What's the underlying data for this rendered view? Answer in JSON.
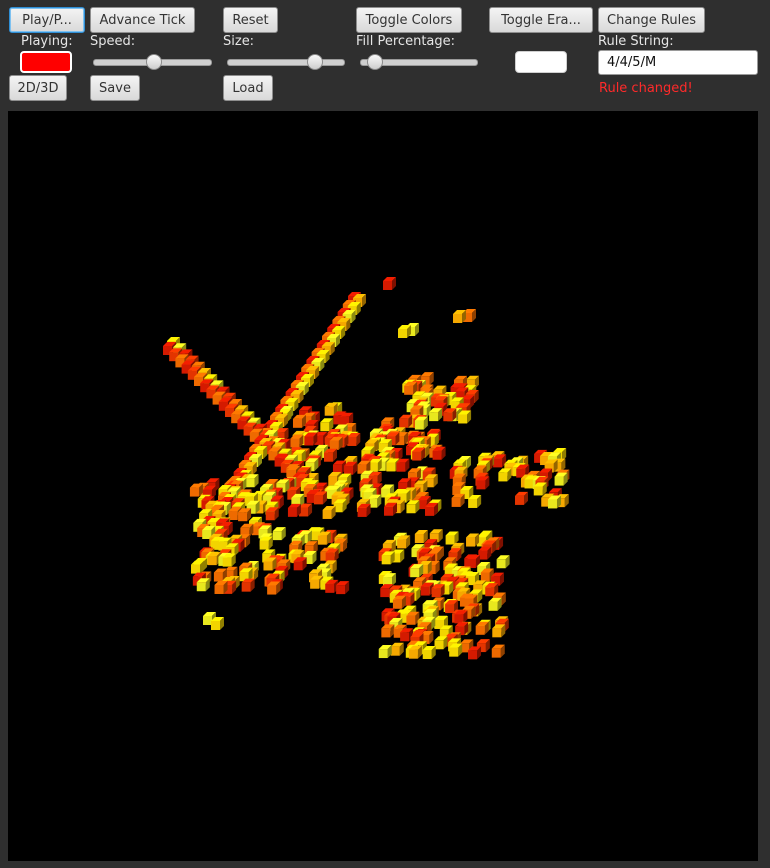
{
  "toolbar": {
    "play_label": "Play/P...",
    "advance_label": "Advance Tick",
    "reset_label": "Reset",
    "toggle_colors_label": "Toggle Colors",
    "toggle_erase_label": "Toggle Era...",
    "change_rules_label": "Change Rules",
    "mode_label": "2D/3D",
    "save_label": "Save",
    "load_label": "Load"
  },
  "controls": {
    "playing_label": "Playing:",
    "playing_color": "#ff0000",
    "speed_label": "Speed:",
    "speed_value": 0.5,
    "size_label": "Size:",
    "size_value": 0.74,
    "fill_label": "Fill Percentage:",
    "fill_value": 0.12,
    "erase_color": "#ffffff",
    "rule_label": "Rule String:",
    "rule_value": "4/4/5/M",
    "status_text": "Rule changed!",
    "status_color": "#ff2a2a"
  },
  "scene": {
    "background": "#000000",
    "palette": [
      "#d41a00",
      "#e33400",
      "#ee6a00",
      "#f5a800",
      "#f2d400",
      "#e8e81e"
    ]
  }
}
